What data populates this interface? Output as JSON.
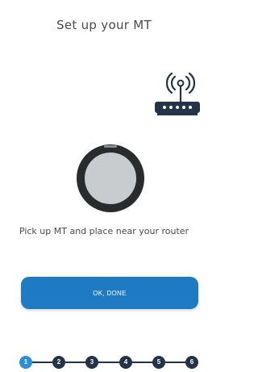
{
  "header": {
    "title": "Set up your MT"
  },
  "icons": {
    "router": "wifi-router-icon",
    "device": "mt-device-icon"
  },
  "instruction": "Pick up MT and place near your router",
  "cta": {
    "label": "OK, DONE"
  },
  "stepper": {
    "steps": [
      "1",
      "2",
      "3",
      "4",
      "5",
      "6"
    ],
    "active_step": 1
  },
  "colors": {
    "accent": "#1e7ac3",
    "step_active": "#2b8fd6",
    "step_default": "#233448",
    "text": "#4a4a4a"
  }
}
